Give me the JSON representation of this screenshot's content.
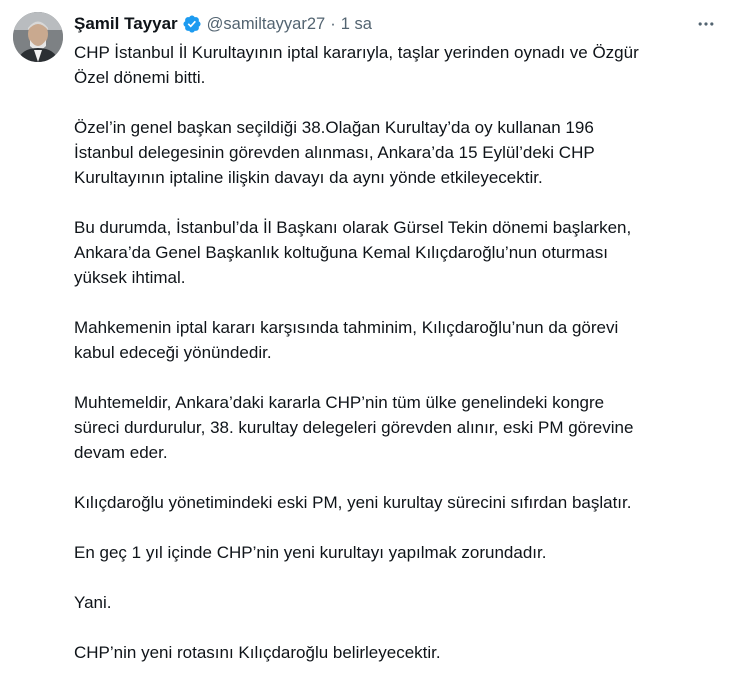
{
  "tweet": {
    "author_name": "Şamil Tayyar",
    "handle": "@samiltayyar27",
    "separator": "·",
    "time": "1 sa",
    "verified_icon": "verified-badge-icon",
    "more_icon": "more-options-icon",
    "paragraphs": [
      "CHP İstanbul İl Kurultayının iptal kararıyla, taşlar yerinden oynadı ve Özgür\nÖzel dönemi bitti.",
      "Özel’in genel başkan seçildiği 38.Olağan Kurultay’da oy kullanan 196\nİstanbul delegesinin görevden alınması, Ankara’da 15 Eylül’deki CHP\nKurultayının iptaline ilişkin davayı da aynı yönde etkileyecektir.",
      "Bu durumda, İstanbul’da İl Başkanı olarak Gürsel Tekin dönemi başlarken,\nAnkara’da Genel Başkanlık koltuğuna Kemal Kılıçdaroğlu’nun oturması\nyüksek ihtimal.",
      "Mahkemenin iptal kararı karşısında tahminim, Kılıçdaroğlu’nun da görevi\nkabul edeceği yönündedir.",
      "Muhtemeldir, Ankara’daki kararla CHP’nin tüm ülke genelindeki kongre\nsüreci durdurulur, 38. kurultay delegeleri görevden alınır, eski PM görevine\ndevam eder.",
      "Kılıçdaroğlu yönetimindeki eski PM, yeni kurultay sürecini sıfırdan başlatır.",
      "En geç 1 yıl içinde CHP’nin yeni kurultayı yapılmak zorundadır.",
      "Yani.",
      "CHP’nin yeni rotasını Kılıçdaroğlu belirleyecektir."
    ]
  },
  "colors": {
    "text": "#0f1419",
    "secondary": "#536471",
    "verified": "#1d9bf0"
  }
}
